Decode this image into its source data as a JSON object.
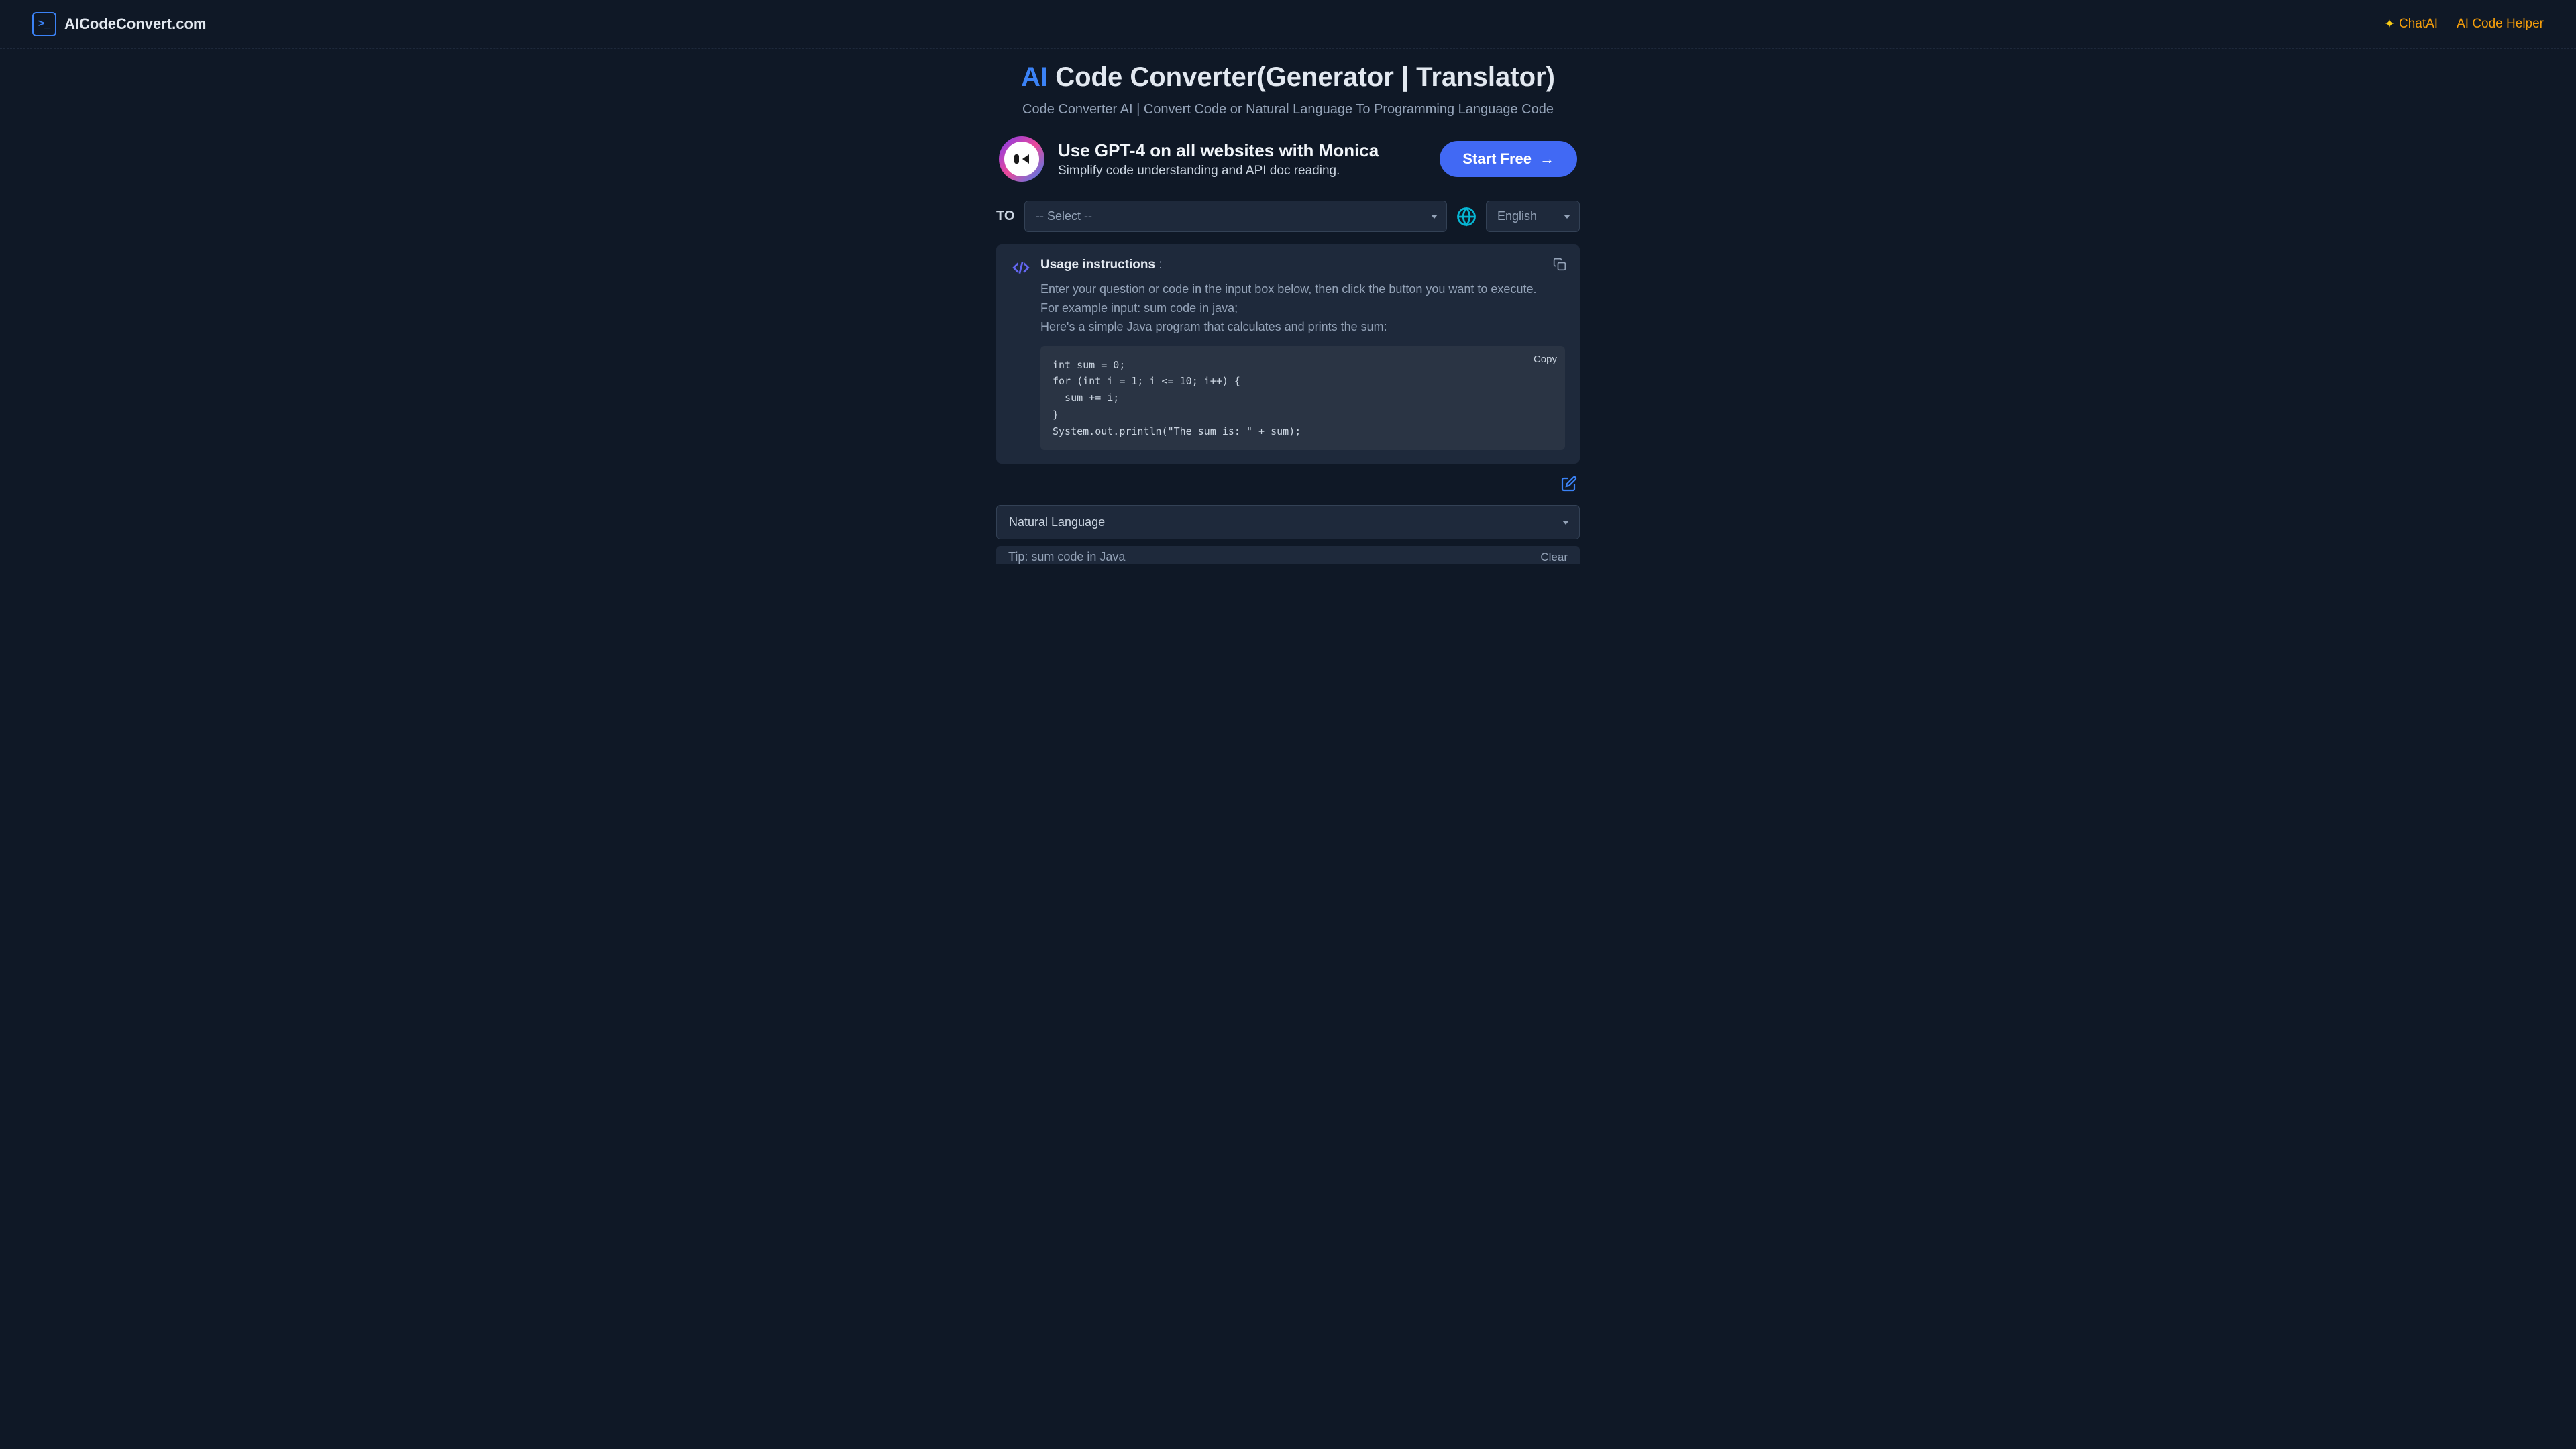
{
  "header": {
    "site_name": "AICodeConvert.com",
    "nav": {
      "chat_ai": "ChatAI",
      "helper": "AI Code Helper"
    }
  },
  "hero": {
    "title_prefix": "AI",
    "title_rest": " Code Converter(Generator | Translator)",
    "subtitle": "Code Converter AI | Convert Code or Natural Language To Programming Language Code"
  },
  "promo": {
    "title": "Use GPT-4 on all websites with Monica",
    "subtitle": "Simplify code understanding and API doc reading.",
    "button": "Start Free"
  },
  "to": {
    "label": "TO",
    "select_placeholder": "-- Select --",
    "language": "English"
  },
  "instructions": {
    "heading": "Usage instructions",
    "line1": "Enter your question or code in the input box below, then click the button you want to execute.",
    "line2": "For example input: sum code in java;",
    "line3": "Here's a simple Java program that calculates and prints the sum:",
    "code": "int sum = 0;\nfor (int i = 1; i <= 10; i++) {\n  sum += i;\n}\nSystem.out.println(\"The sum is: \" + sum);",
    "copy_label": "Copy"
  },
  "input": {
    "mode": "Natural Language",
    "tip": "Tip: sum code in Java",
    "clear": "Clear"
  }
}
